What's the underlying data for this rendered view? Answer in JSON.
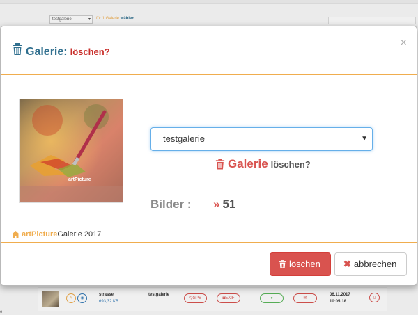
{
  "background": {
    "select_value": "testgalerie",
    "hint_text": "für 1 Galerie",
    "hint_link": "wählen",
    "row": {
      "name": "strasse",
      "size": "693,32 KB",
      "gallery": "testgalerie",
      "gps_label": "GPS",
      "exif_label": "EXIF",
      "date": "06.11.2017",
      "time": "10:05:18"
    },
    "corner_text": "e"
  },
  "modal": {
    "title_main": "Galerie:",
    "title_sub": "löschen?",
    "close_symbol": "×",
    "gallery_select_value": "testgalerie",
    "delete_gallery_word": "Galerie",
    "delete_question": "löschen?",
    "bilder_label": "Bilder :",
    "bilder_count": "51",
    "brand_name": "artPicture",
    "brand_suffix": "Galerie 2017",
    "thumb_caption": "artPicture",
    "buttons": {
      "delete_label": "löschen",
      "cancel_label": "abbrechen"
    }
  },
  "colors": {
    "title_blue": "#31708f",
    "danger": "#d9534f",
    "accent_orange": "#f0ad4e"
  },
  "icons": [
    "trash-icon",
    "close-icon",
    "caret-down-icon",
    "double-chevron-icon",
    "home-icon",
    "times-icon",
    "map-marker-icon",
    "camera-icon",
    "user-icon",
    "envelope-icon",
    "pencil-icon",
    "eye-icon"
  ]
}
